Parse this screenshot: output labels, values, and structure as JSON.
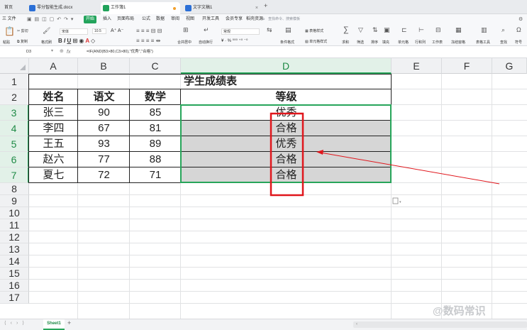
{
  "titlebar": {
    "tabs": [
      {
        "label": "首页",
        "color": "#2b6fd6",
        "active": false
      },
      {
        "label": "零分智能生成.docx",
        "color": "#2b6fd6",
        "active": false
      },
      {
        "label": "工作簿1",
        "color": "#22a35b",
        "active": true
      },
      {
        "label": "文字文稿1",
        "color": "#2b6fd6",
        "active": false
      }
    ],
    "new_tab": "+"
  },
  "menu": {
    "file": "三 文件",
    "start": "开始",
    "items": [
      "插入",
      "页面布局",
      "公式",
      "数据",
      "审阅",
      "视图",
      "开发工具",
      "会员专享",
      "稻壳资源"
    ],
    "search_placeholder": "查找命令、搜索模板"
  },
  "ribbon": {
    "paste": "粘贴",
    "cut": "剪切",
    "copy": "复制",
    "format_painter": "格式刷",
    "font_name": "宋体",
    "font_size": "10.5",
    "merge_center": "合并居中",
    "wrap_text": "自动换行",
    "number_format": "常规",
    "conditional_format": "条件格式",
    "table_style": "表格样式",
    "cell_style": "单元格样式",
    "sum": "求和",
    "filter": "筛选",
    "sort": "排序",
    "fill": "填充",
    "cell": "单元格",
    "row_col": "行和列",
    "worksheet": "工作表",
    "freeze": "冻结窗格",
    "table_tools": "表格工具",
    "find": "查找",
    "symbol": "符号"
  },
  "formula_bar": {
    "name_box": "D3",
    "fx": "fx",
    "formula": "=IF(AND(B3>80,C3>80),\"优秀\",\"合格\")"
  },
  "grid": {
    "columns": [
      "A",
      "B",
      "C",
      "D",
      "E",
      "F",
      "G"
    ],
    "selected_column": "D",
    "rows": [
      "1",
      "2",
      "3",
      "4",
      "5",
      "6",
      "7",
      "8",
      "9",
      "10",
      "11",
      "12",
      "13",
      "14",
      "15",
      "16",
      "17"
    ],
    "title": "学生成绩表",
    "headers": [
      "姓名",
      "语文",
      "数学",
      "等级"
    ],
    "data": [
      [
        "张三",
        "90",
        "85",
        "优秀"
      ],
      [
        "李四",
        "67",
        "81",
        "合格"
      ],
      [
        "王五",
        "93",
        "89",
        "优秀"
      ],
      [
        "赵六",
        "77",
        "88",
        "合格"
      ],
      [
        "夏七",
        "72",
        "71",
        "合格"
      ]
    ]
  },
  "statusbar": {
    "sheet_tab": "Sheet1",
    "add_sheet": "+"
  },
  "watermark": "@数码常识",
  "colors": {
    "accent_green": "#22a35b",
    "selection_gray": "#d6d6d6",
    "highlight_red": "#e0161c"
  }
}
